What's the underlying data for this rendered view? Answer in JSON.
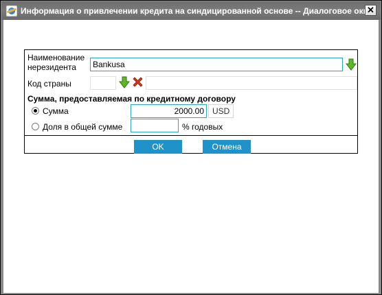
{
  "window": {
    "title": "Информация о привлечении кредита на синдицированной основе -- Диалоговое окн...",
    "close_glyph": "✕"
  },
  "form": {
    "nonresident_label_line1": "Наименование",
    "nonresident_label_line2": "нерезидента",
    "nonresident_value": "Bankusa",
    "country_code_label": "Код страны",
    "country_code_value": "",
    "section_heading": "Сумма, предоставляемая по кредитному договору",
    "option_amount_label": "Сумма",
    "option_amount_selected": true,
    "amount_value": "2000.00",
    "currency": "USD",
    "option_share_label": "Доля в общей сумме",
    "share_value": "",
    "share_unit": "% годовых"
  },
  "buttons": {
    "ok_label": "OK",
    "cancel_label": "Отмена"
  },
  "icons": {
    "pick": "arrow-down-icon",
    "clear": "delete-x-icon"
  },
  "colors": {
    "titlebar": "#737373",
    "button": "#1f93c9",
    "arrow_green": "#5cb82a",
    "delete_red": "#d9361c"
  }
}
